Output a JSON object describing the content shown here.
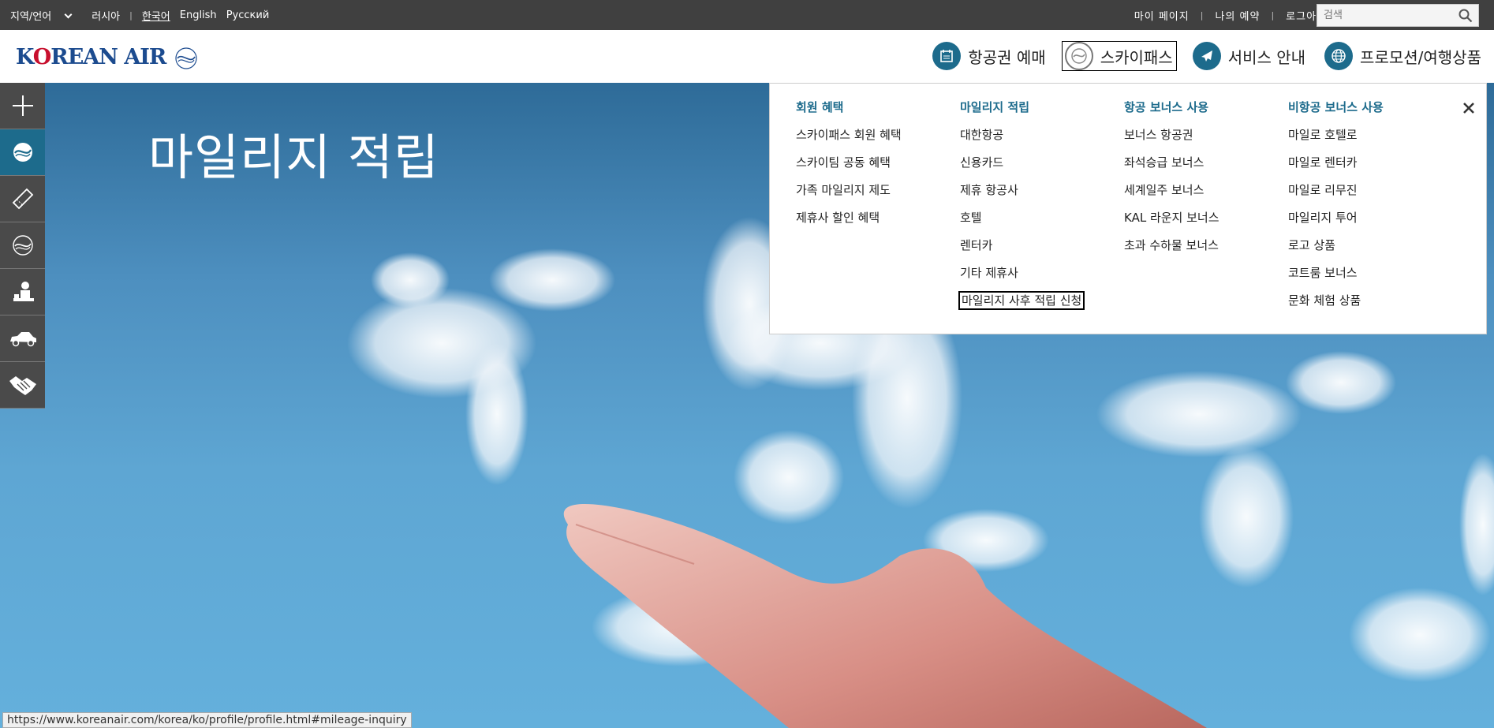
{
  "topbar": {
    "region_language": "지역/언어",
    "country": "러시아",
    "languages": [
      "한국어",
      "English",
      "Русский"
    ],
    "my_page": "마이 페이지",
    "my_reservations": "나의 예약",
    "logout": "로그아웃",
    "search_placeholder": "검색"
  },
  "header": {
    "logo_text": "KOREAN AIR",
    "nav": [
      {
        "label": "항공권 예매",
        "icon": "calendar-icon"
      },
      {
        "label": "스카이패스",
        "icon": "skypass-icon"
      },
      {
        "label": "서비스 안내",
        "icon": "airplane-icon"
      },
      {
        "label": "프로모션/여행상품",
        "icon": "globe-icon"
      }
    ]
  },
  "hero": {
    "title": "마일리지 적립"
  },
  "sidebar": {
    "items": [
      "plus-icon",
      "skypass-icon",
      "ticket-icon",
      "skyteam-icon",
      "agent-icon",
      "car-icon",
      "handshake-icon"
    ]
  },
  "dropdown": {
    "columns": [
      {
        "heading": "회원 혜택",
        "items": [
          "스카이패스 회원 혜택",
          "스카이팀 공동 혜택",
          "가족 마일리지 제도",
          "제휴사 할인 혜택"
        ]
      },
      {
        "heading": "마일리지 적립",
        "items": [
          "대한항공",
          "신용카드",
          "제휴 항공사",
          "호텔",
          "렌터카",
          "기타 제휴사",
          "마일리지 사후 적립 신청"
        ]
      },
      {
        "heading": "항공 보너스 사용",
        "items": [
          "보너스 항공권",
          "좌석승급 보너스",
          "세계일주 보너스",
          "KAL 라운지 보너스",
          "초과 수하물 보너스"
        ]
      },
      {
        "heading": "비항공 보너스 사용",
        "items": [
          "마일로 호텔로",
          "마일로 렌터카",
          "마일로 리무진",
          "마일리지 투어",
          "로고 상품",
          "코트룸 보너스",
          "문화 체험 상품"
        ]
      }
    ]
  },
  "status_url": "https://www.koreanair.com/korea/ko/profile/profile.html#mileage-inquiry",
  "colors": {
    "accent": "#1d6b8c",
    "topbar": "#404040"
  }
}
